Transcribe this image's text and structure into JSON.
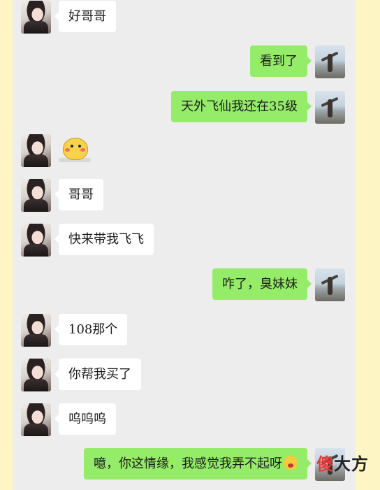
{
  "messages": [
    {
      "side": "left",
      "text": "好哥哥"
    },
    {
      "side": "right",
      "text": "看到了"
    },
    {
      "side": "right",
      "text": "天外飞仙我还在35级"
    },
    {
      "side": "left",
      "sticker": "yellow-chick-sticker"
    },
    {
      "side": "left",
      "text": "哥哥"
    },
    {
      "side": "left",
      "text": "快来带我飞飞"
    },
    {
      "side": "right",
      "text": "咋了，臭妹妹"
    },
    {
      "side": "left",
      "text": "108那个"
    },
    {
      "side": "left",
      "text": "你帮我买了"
    },
    {
      "side": "left",
      "text": "呜呜呜"
    },
    {
      "side": "right",
      "text": "噫，你这情缘，我感觉我弄不起呀",
      "emoji": "flushed-face-emoji"
    }
  ],
  "watermark": {
    "part1": "傻",
    "part2": "大方"
  },
  "colors": {
    "page_bg": "#fdf6c4",
    "chat_bg": "#ededed",
    "sent_bubble": "#95ec69",
    "received_bubble": "#ffffff"
  }
}
